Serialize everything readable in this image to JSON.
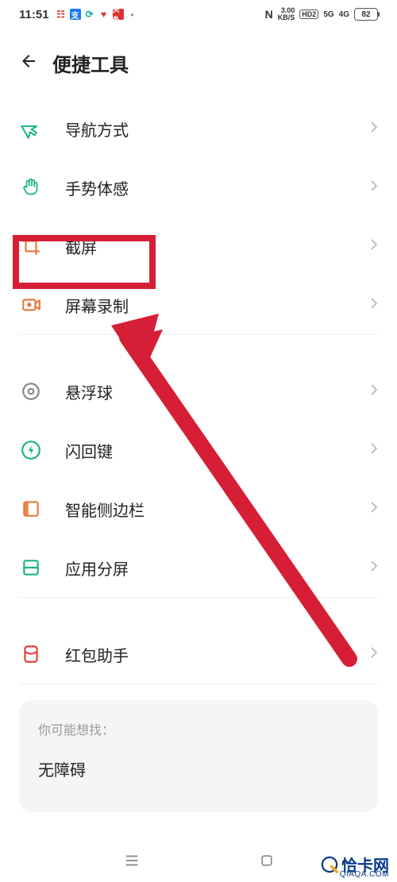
{
  "status": {
    "time": "11:51",
    "network_speed": "3.00",
    "network_unit": "KB/S",
    "hd_badge": "HD2",
    "sig1": "5G",
    "sig2": "4G",
    "battery": "82"
  },
  "header": {
    "title": "便捷工具"
  },
  "items": [
    {
      "label": "导航方式",
      "icon": "cursor"
    },
    {
      "label": "手势体感",
      "icon": "hand"
    },
    {
      "label": "截屏",
      "icon": "crop"
    },
    {
      "label": "屏幕录制",
      "icon": "record"
    },
    {
      "label": "悬浮球",
      "icon": "circle-dot"
    },
    {
      "label": "闪回键",
      "icon": "flash"
    },
    {
      "label": "智能侧边栏",
      "icon": "sidebar"
    },
    {
      "label": "应用分屏",
      "icon": "split"
    },
    {
      "label": "红包助手",
      "icon": "redpacket"
    }
  ],
  "suggestion": {
    "hint": "你可能想找：",
    "term": "无障碍"
  },
  "watermark": {
    "brand": "恰卡网",
    "domain": "QIAQA.COM"
  }
}
